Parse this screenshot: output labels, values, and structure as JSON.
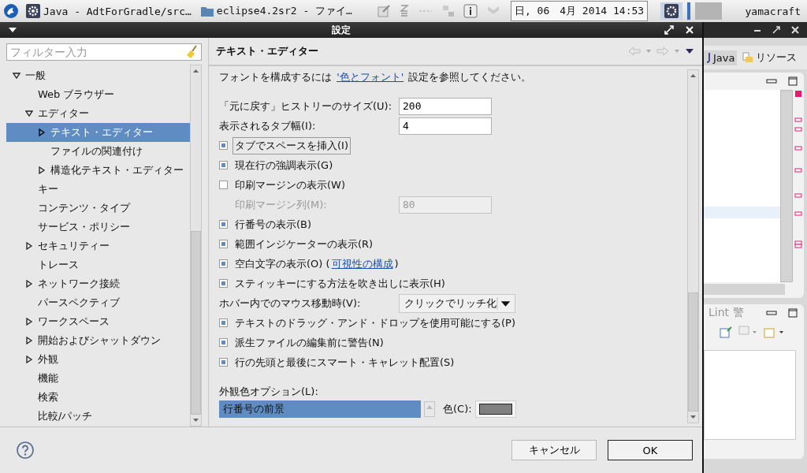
{
  "taskbar": {
    "windows": [
      {
        "kind": "app",
        "title": "Java - AdtForGradle/src…"
      },
      {
        "kind": "folder",
        "title": "eclipse4.2sr2 - ファイ…"
      }
    ],
    "clock": "日, 06　4月 2014 14:53",
    "user": "yamacraft"
  },
  "dialog": {
    "title": "設定",
    "filter": {
      "placeholder": "フィルター入力"
    },
    "tree": [
      {
        "kind": "node",
        "label": "一般",
        "expanded": true,
        "selected": false,
        "children": [
          {
            "kind": "leaf",
            "label": "Web ブラウザー",
            "selected": false
          },
          {
            "kind": "node",
            "label": "エディター",
            "expanded": true,
            "selected": false,
            "children": [
              {
                "kind": "node",
                "label": "テキスト・エディター",
                "expanded": false,
                "selected": true
              },
              {
                "kind": "leaf",
                "label": "ファイルの関連付け",
                "selected": false
              },
              {
                "kind": "node",
                "label": "構造化テキスト・エディター",
                "expanded": false,
                "selected": false
              }
            ]
          },
          {
            "kind": "leaf",
            "label": "キー",
            "selected": false
          },
          {
            "kind": "leaf",
            "label": "コンテンツ・タイプ",
            "selected": false
          },
          {
            "kind": "leaf",
            "label": "サービス・ポリシー",
            "selected": false
          },
          {
            "kind": "node",
            "label": "セキュリティー",
            "expanded": false,
            "selected": false
          },
          {
            "kind": "leaf",
            "label": "トレース",
            "selected": false
          },
          {
            "kind": "node",
            "label": "ネットワーク接続",
            "expanded": false,
            "selected": false
          },
          {
            "kind": "leaf",
            "label": "パースペクティブ",
            "selected": false
          },
          {
            "kind": "node",
            "label": "ワークスペース",
            "expanded": false,
            "selected": false
          },
          {
            "kind": "node",
            "label": "開始およびシャットダウン",
            "expanded": false,
            "selected": false
          },
          {
            "kind": "node",
            "label": "外観",
            "expanded": false,
            "selected": false
          },
          {
            "kind": "leaf",
            "label": "機能",
            "selected": false
          },
          {
            "kind": "leaf",
            "label": "検索",
            "selected": false
          },
          {
            "kind": "leaf",
            "label": "比較/パッチ",
            "selected": false
          }
        ]
      }
    ],
    "page": {
      "title": "テキスト・エディター",
      "intro": {
        "before": "フォントを構成するには ",
        "link": "'色とフォント'",
        "after": " 設定を参照してください。"
      },
      "settings": [
        {
          "kind": "field",
          "label": "「元に戻す」ヒストリーのサイズ(U):",
          "value": "200",
          "disabled": false
        },
        {
          "kind": "field",
          "label": "表示されるタブ幅(I):",
          "value": "4",
          "disabled": false
        },
        {
          "kind": "checkbox",
          "label": "タブでスペースを挿入(I)",
          "checked": true,
          "focused": true
        },
        {
          "kind": "checkbox",
          "label": "現在行の強調表示(G)",
          "checked": true,
          "focused": false
        },
        {
          "kind": "checkbox",
          "label": "印刷マージンの表示(W)",
          "checked": false,
          "focused": false
        },
        {
          "kind": "field",
          "label": "印刷マージン列(M):",
          "value": "80",
          "disabled": true
        },
        {
          "kind": "checkbox",
          "label": "行番号の表示(B)",
          "checked": true,
          "focused": false
        },
        {
          "kind": "checkbox",
          "label": "範囲インジケーターの表示(R)",
          "checked": true,
          "focused": false
        },
        {
          "kind": "checkbox",
          "label": "空白文字の表示(O) (",
          "link": "可視性の構成",
          "suffix": ")",
          "checked": true,
          "focused": false
        },
        {
          "kind": "checkbox",
          "label": "スティッキーにする方法を吹き出しに表示(H)",
          "checked": true,
          "focused": false
        },
        {
          "kind": "combo",
          "label": "ホバー内でのマウス移動時(V):",
          "value": "クリックでリッチ化"
        },
        {
          "kind": "checkbox",
          "label": "テキストのドラッグ・アンド・ドロップを使用可能にする(P)",
          "checked": true,
          "focused": false
        },
        {
          "kind": "checkbox",
          "label": "派生ファイルの編集前に警告(N)",
          "checked": true,
          "focused": false
        },
        {
          "kind": "checkbox",
          "label": "行の先頭と最後にスマート・キャレット配置(S)",
          "checked": true,
          "focused": false
        }
      ],
      "appearance": {
        "label": "外観色オプション(L):",
        "items": [
          {
            "label": "行番号の前景",
            "selected": true
          }
        ],
        "color_label": "色(C):",
        "color": "#808080"
      }
    },
    "buttons": [
      {
        "label": "キャンセル",
        "default": false
      },
      {
        "label": "OK",
        "default": true
      }
    ]
  },
  "background_window": {
    "perspectives": [
      {
        "label": "Java",
        "selected": true
      },
      {
        "label": "リソース",
        "selected": false
      }
    ],
    "panel_tab": "Lint 警"
  }
}
